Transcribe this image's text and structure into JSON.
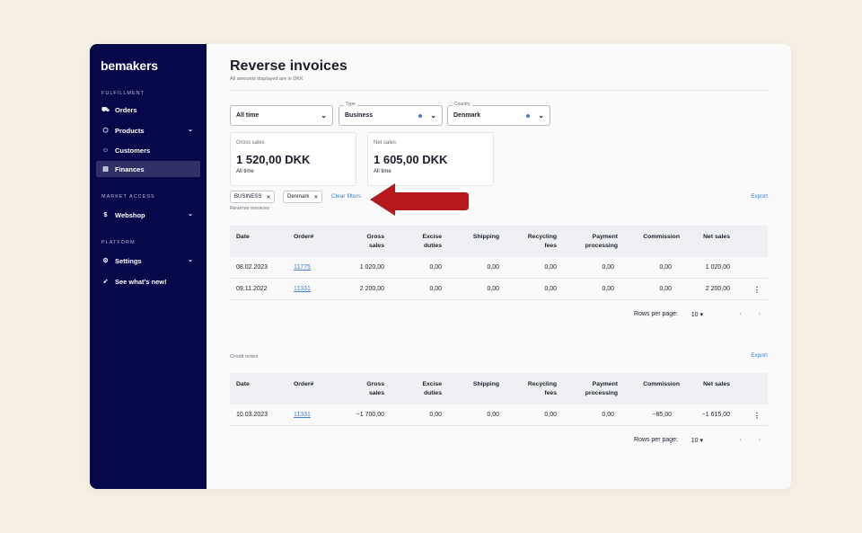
{
  "sidebar": {
    "logo": "bemakers",
    "sections": [
      "FULFILLMENT",
      "MARKET ACCESS",
      "PLATFORM"
    ],
    "items": [
      {
        "label": "Orders",
        "icon": "truck-icon"
      },
      {
        "label": "Products",
        "icon": "box-icon"
      },
      {
        "label": "Customers",
        "icon": "users-icon"
      },
      {
        "label": "Finances",
        "icon": "document-icon",
        "active": true
      },
      {
        "label": "Webshop",
        "icon": "dollar-icon"
      },
      {
        "label": "Settings",
        "icon": "gear-icon"
      },
      {
        "label": "See what's new!",
        "icon": "rocket-icon"
      }
    ]
  },
  "header": {
    "title": "Reverse invoices",
    "subtitle": "All amounts displayed are in DKK"
  },
  "filters": {
    "period": {
      "value": "All time"
    },
    "type": {
      "label": "Type",
      "value": "Business"
    },
    "country": {
      "label": "Country",
      "value": "Denmark"
    }
  },
  "summary": {
    "gross": {
      "label": "Gross sales",
      "value": "1 520,00 DKK",
      "sub": "All time"
    },
    "net": {
      "label": "Net sales",
      "value": "1 605,00 DKK",
      "sub": "All time"
    }
  },
  "chips": [
    "BUSINESS",
    "Denmark"
  ],
  "clear_filters": "Clear filters",
  "export": "Export",
  "columns": [
    "Date",
    "Order#",
    "Gross\nsales",
    "Excise\nduties",
    "Shipping",
    "Recycling\nfees",
    "Payment\nprocessing",
    "Commission",
    "Net sales"
  ],
  "invoices": {
    "caption": "Reverse invoices",
    "rows": [
      [
        "08.02.2023",
        "11775",
        "1 020,00",
        "0,00",
        "0,00",
        "0,00",
        "0,00",
        "0,00",
        "1 020,00"
      ],
      [
        "09.11.2022",
        "11331",
        "2 200,00",
        "0,00",
        "0,00",
        "0,00",
        "0,00",
        "0,00",
        "2 200,00"
      ]
    ]
  },
  "credit_notes": {
    "caption": "Credit notes",
    "rows": [
      [
        "10.03.2023",
        "11331",
        "−1 700,00",
        "0,00",
        "0,00",
        "0,00",
        "0,00",
        "−85,00",
        "−1 615,00"
      ]
    ]
  },
  "pager": {
    "rows_label": "Rows per page:",
    "rows_value": "10"
  },
  "colors": {
    "sidebar": "#07084a",
    "accent": "#3f7fd8",
    "arrow": "#b5191e",
    "background": "#f6efe4"
  }
}
